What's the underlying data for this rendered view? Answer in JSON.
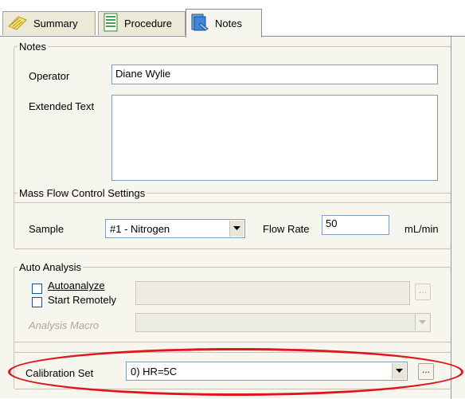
{
  "tabs": [
    {
      "label": "Summary",
      "icon": "summary-icon",
      "active": false
    },
    {
      "label": "Procedure",
      "icon": "procedure-icon",
      "active": false
    },
    {
      "label": "Notes",
      "icon": "notes-icon",
      "active": true
    }
  ],
  "notes": {
    "title": "Notes",
    "operator_label": "Operator",
    "operator_value": "Diane Wylie",
    "extended_label": "Extended Text",
    "extended_value": ""
  },
  "mfc": {
    "title": "Mass Flow Control Settings",
    "sample_label": "Sample",
    "sample_value": "#1 - Nitrogen",
    "flow_label": "Flow Rate",
    "flow_value": "50",
    "flow_unit": "mL/min"
  },
  "auto": {
    "title": "Auto Analysis",
    "autoanalyze_label": "Autoanalyze",
    "autoanalyze_checked": false,
    "start_remotely_label": "Start Remotely",
    "start_remotely_checked": false,
    "path_value": "",
    "browse_label": "...",
    "macro_label": "Analysis Macro",
    "macro_value": ""
  },
  "calibration": {
    "label": "Calibration Set",
    "value": "0) HR=5C",
    "browse_label": "..."
  },
  "colors": {
    "highlight": "#e2141b",
    "panel_bg": "#f7f6ee"
  }
}
